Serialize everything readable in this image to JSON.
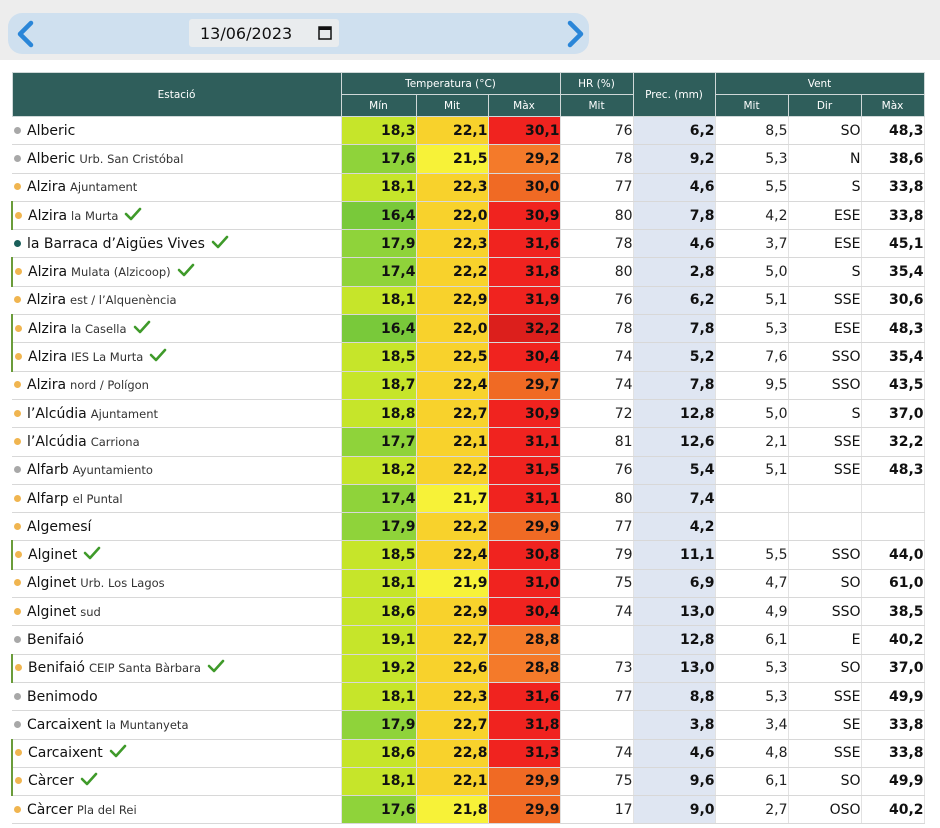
{
  "date_selector": {
    "value": "13/06/2023"
  },
  "colors": {
    "header": "#2f5e5b",
    "precip_bg": "#dfe6f2",
    "dot_gray": "#a8a8a8",
    "dot_orange": "#f0b550",
    "dot_teal": "#1a5f5a",
    "check_green": "#3f9a2a"
  },
  "header": {
    "estacio": "Estació",
    "temperatura": "Temperatura (°C)",
    "hr": "HR (%)",
    "prec": "Prec. (mm)",
    "vent": "Vent",
    "min": "Mín",
    "mit": "Mit",
    "max": "Màx",
    "hr_mit": "Mit",
    "vent_mit": "Mit",
    "vent_dir": "Dir",
    "vent_max": "Màx"
  },
  "rows": [
    {
      "name": "Alberic",
      "sub": "",
      "dot": "gray",
      "check": false,
      "marked": false,
      "tmin": "18,3",
      "tmit": "22,1",
      "tmax": "30,1",
      "hr": "76",
      "prec": "6,2",
      "wmit": "8,5",
      "wdir": "SO",
      "wmax": "48,3",
      "cmin": "#c6e52a",
      "cmit": "#f8d22c",
      "cmax": "#f0231f"
    },
    {
      "name": "Alberic",
      "sub": "Urb. San Cristóbal",
      "dot": "gray",
      "check": false,
      "marked": false,
      "tmin": "17,6",
      "tmit": "21,5",
      "tmax": "29,2",
      "hr": "78",
      "prec": "9,2",
      "wmit": "5,3",
      "wdir": "N",
      "wmax": "38,6",
      "cmin": "#8fd33a",
      "cmit": "#f7f238",
      "cmax": "#f47a2a"
    },
    {
      "name": "Alzira",
      "sub": "Ajuntament",
      "dot": "orange",
      "check": false,
      "marked": false,
      "tmin": "18,1",
      "tmit": "22,3",
      "tmax": "30,0",
      "hr": "77",
      "prec": "4,6",
      "wmit": "5,5",
      "wdir": "S",
      "wmax": "33,8",
      "cmin": "#c6e52a",
      "cmit": "#f8d22c",
      "cmax": "#f06a24"
    },
    {
      "name": "Alzira",
      "sub": "la Murta",
      "dot": "orange",
      "check": true,
      "marked": true,
      "tmin": "16,4",
      "tmit": "22,0",
      "tmax": "30,9",
      "hr": "80",
      "prec": "7,8",
      "wmit": "4,2",
      "wdir": "ESE",
      "wmax": "33,8",
      "cmin": "#79c93a",
      "cmit": "#f8d22c",
      "cmax": "#f0231f"
    },
    {
      "name": "la Barraca d’Aigües Vives",
      "sub": "",
      "dot": "teal",
      "check": true,
      "marked": false,
      "tmin": "17,9",
      "tmit": "22,3",
      "tmax": "31,6",
      "hr": "78",
      "prec": "4,6",
      "wmit": "3,7",
      "wdir": "ESE",
      "wmax": "45,1",
      "cmin": "#8fd33a",
      "cmit": "#f8d22c",
      "cmax": "#f0231f"
    },
    {
      "name": "Alzira",
      "sub": "Mulata (Alzicoop)",
      "dot": "orange",
      "check": true,
      "marked": true,
      "tmin": "17,4",
      "tmit": "22,2",
      "tmax": "31,8",
      "hr": "80",
      "prec": "2,8",
      "wmit": "5,0",
      "wdir": "S",
      "wmax": "35,4",
      "cmin": "#8fd33a",
      "cmit": "#f8d22c",
      "cmax": "#f0231f"
    },
    {
      "name": "Alzira",
      "sub": "est / l’Alquenència",
      "dot": "orange",
      "check": false,
      "marked": false,
      "tmin": "18,1",
      "tmit": "22,9",
      "tmax": "31,9",
      "hr": "76",
      "prec": "6,2",
      "wmit": "5,1",
      "wdir": "SSE",
      "wmax": "30,6",
      "cmin": "#c6e52a",
      "cmit": "#f8d22c",
      "cmax": "#f0231f"
    },
    {
      "name": "Alzira",
      "sub": "la Casella",
      "dot": "orange",
      "check": true,
      "marked": true,
      "tmin": "16,4",
      "tmit": "22,0",
      "tmax": "32,2",
      "hr": "78",
      "prec": "7,8",
      "wmit": "5,3",
      "wdir": "ESE",
      "wmax": "48,3",
      "cmin": "#79c93a",
      "cmit": "#f8d22c",
      "cmax": "#dc1f1c"
    },
    {
      "name": "Alzira",
      "sub": "IES La Murta",
      "dot": "orange",
      "check": true,
      "marked": true,
      "tmin": "18,5",
      "tmit": "22,5",
      "tmax": "30,4",
      "hr": "74",
      "prec": "5,2",
      "wmit": "7,6",
      "wdir": "SSO",
      "wmax": "35,4",
      "cmin": "#c6e52a",
      "cmit": "#f8d22c",
      "cmax": "#f0231f"
    },
    {
      "name": "Alzira",
      "sub": "nord / Polígon",
      "dot": "orange",
      "check": false,
      "marked": false,
      "tmin": "18,7",
      "tmit": "22,4",
      "tmax": "29,7",
      "hr": "74",
      "prec": "7,8",
      "wmit": "9,5",
      "wdir": "SSO",
      "wmax": "43,5",
      "cmin": "#c6e52a",
      "cmit": "#f8d22c",
      "cmax": "#f06a24"
    },
    {
      "name": "l’Alcúdia",
      "sub": "Ajuntament",
      "dot": "orange",
      "check": false,
      "marked": false,
      "tmin": "18,8",
      "tmit": "22,7",
      "tmax": "30,9",
      "hr": "72",
      "prec": "12,8",
      "wmit": "5,0",
      "wdir": "S",
      "wmax": "37,0",
      "cmin": "#c6e52a",
      "cmit": "#f8d22c",
      "cmax": "#f0231f"
    },
    {
      "name": "l’Alcúdia",
      "sub": "Carriona",
      "dot": "orange",
      "check": false,
      "marked": false,
      "tmin": "17,7",
      "tmit": "22,1",
      "tmax": "31,1",
      "hr": "81",
      "prec": "12,6",
      "wmit": "2,1",
      "wdir": "SSE",
      "wmax": "32,2",
      "cmin": "#8fd33a",
      "cmit": "#f8d22c",
      "cmax": "#f0231f"
    },
    {
      "name": "Alfarb",
      "sub": "Ayuntamiento",
      "dot": "gray",
      "check": false,
      "marked": false,
      "tmin": "18,2",
      "tmit": "22,2",
      "tmax": "31,5",
      "hr": "76",
      "prec": "5,4",
      "wmit": "5,1",
      "wdir": "SSE",
      "wmax": "48,3",
      "cmin": "#c6e52a",
      "cmit": "#f8d22c",
      "cmax": "#f0231f"
    },
    {
      "name": "Alfarp",
      "sub": "el Puntal",
      "dot": "orange",
      "check": false,
      "marked": false,
      "tmin": "17,4",
      "tmit": "21,7",
      "tmax": "31,1",
      "hr": "80",
      "prec": "7,4",
      "wmit": "",
      "wdir": "",
      "wmax": "",
      "cmin": "#8fd33a",
      "cmit": "#f7f238",
      "cmax": "#f0231f"
    },
    {
      "name": "Algemesí",
      "sub": "",
      "dot": "orange",
      "check": false,
      "marked": false,
      "tmin": "17,9",
      "tmit": "22,2",
      "tmax": "29,9",
      "hr": "77",
      "prec": "4,2",
      "wmit": "",
      "wdir": "",
      "wmax": "",
      "cmin": "#8fd33a",
      "cmit": "#f8d22c",
      "cmax": "#f06a24"
    },
    {
      "name": "Alginet",
      "sub": "",
      "dot": "orange",
      "check": true,
      "marked": true,
      "tmin": "18,5",
      "tmit": "22,4",
      "tmax": "30,8",
      "hr": "79",
      "prec": "11,1",
      "wmit": "5,5",
      "wdir": "SSO",
      "wmax": "44,0",
      "cmin": "#c6e52a",
      "cmit": "#f8d22c",
      "cmax": "#f0231f"
    },
    {
      "name": "Alginet",
      "sub": "Urb. Los Lagos",
      "dot": "orange",
      "check": false,
      "marked": false,
      "tmin": "18,1",
      "tmit": "21,9",
      "tmax": "31,0",
      "hr": "75",
      "prec": "6,9",
      "wmit": "4,7",
      "wdir": "SO",
      "wmax": "61,0",
      "cmin": "#c6e52a",
      "cmit": "#f7f238",
      "cmax": "#f0231f"
    },
    {
      "name": "Alginet",
      "sub": "sud",
      "dot": "orange",
      "check": false,
      "marked": false,
      "tmin": "18,6",
      "tmit": "22,9",
      "tmax": "30,4",
      "hr": "74",
      "prec": "13,0",
      "wmit": "4,9",
      "wdir": "SSO",
      "wmax": "38,5",
      "cmin": "#c6e52a",
      "cmit": "#f8d22c",
      "cmax": "#f0231f"
    },
    {
      "name": "Benifaió",
      "sub": "",
      "dot": "gray",
      "check": false,
      "marked": false,
      "tmin": "19,1",
      "tmit": "22,7",
      "tmax": "28,8",
      "hr": "",
      "prec": "12,8",
      "wmit": "6,1",
      "wdir": "E",
      "wmax": "40,2",
      "cmin": "#c6e52a",
      "cmit": "#f8d22c",
      "cmax": "#f47a2a"
    },
    {
      "name": "Benifaió",
      "sub": "CEIP Santa Bàrbara",
      "dot": "orange",
      "check": true,
      "marked": true,
      "tmin": "19,2",
      "tmit": "22,6",
      "tmax": "28,8",
      "hr": "73",
      "prec": "13,0",
      "wmit": "5,3",
      "wdir": "SO",
      "wmax": "37,0",
      "cmin": "#c6e52a",
      "cmit": "#f8d22c",
      "cmax": "#f47a2a"
    },
    {
      "name": "Benimodo",
      "sub": "",
      "dot": "gray",
      "check": false,
      "marked": false,
      "tmin": "18,1",
      "tmit": "22,3",
      "tmax": "31,6",
      "hr": "77",
      "prec": "8,8",
      "wmit": "5,3",
      "wdir": "SSE",
      "wmax": "49,9",
      "cmin": "#c6e52a",
      "cmit": "#f8d22c",
      "cmax": "#f0231f"
    },
    {
      "name": "Carcaixent",
      "sub": "la Muntanyeta",
      "dot": "gray",
      "check": false,
      "marked": false,
      "tmin": "17,9",
      "tmit": "22,7",
      "tmax": "31,8",
      "hr": "",
      "prec": "3,8",
      "wmit": "3,4",
      "wdir": "SE",
      "wmax": "33,8",
      "cmin": "#8fd33a",
      "cmit": "#f8d22c",
      "cmax": "#f0231f"
    },
    {
      "name": "Carcaixent",
      "sub": "",
      "dot": "orange",
      "check": true,
      "marked": true,
      "tmin": "18,6",
      "tmit": "22,8",
      "tmax": "31,3",
      "hr": "74",
      "prec": "4,6",
      "wmit": "4,8",
      "wdir": "SSE",
      "wmax": "33,8",
      "cmin": "#c6e52a",
      "cmit": "#f8d22c",
      "cmax": "#f0231f"
    },
    {
      "name": "Càrcer",
      "sub": "",
      "dot": "orange",
      "check": true,
      "marked": true,
      "tmin": "18,1",
      "tmit": "22,1",
      "tmax": "29,9",
      "hr": "75",
      "prec": "9,6",
      "wmit": "6,1",
      "wdir": "SO",
      "wmax": "49,9",
      "cmin": "#c6e52a",
      "cmit": "#f8d22c",
      "cmax": "#f06a24"
    },
    {
      "name": "Càrcer",
      "sub": "Pla del Rei",
      "dot": "orange",
      "check": false,
      "marked": false,
      "tmin": "17,6",
      "tmit": "21,8",
      "tmax": "29,9",
      "hr": "17",
      "prec": "9,0",
      "wmit": "2,7",
      "wdir": "OSO",
      "wmax": "40,2",
      "cmin": "#8fd33a",
      "cmit": "#f7f238",
      "cmax": "#f06a24"
    }
  ]
}
